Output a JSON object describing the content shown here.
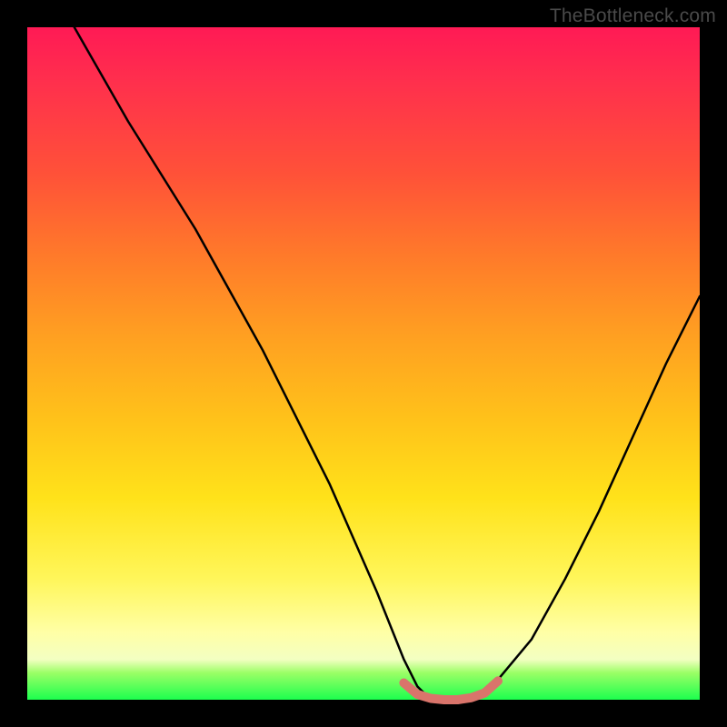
{
  "watermark": "TheBottleneck.com",
  "chart_data": {
    "type": "line",
    "title": "",
    "xlabel": "",
    "ylabel": "",
    "xlim": [
      0,
      100
    ],
    "ylim": [
      0,
      100
    ],
    "grid": false,
    "legend": false,
    "background_gradient": {
      "stops": [
        {
          "pct": 0,
          "color": "#ff1a55"
        },
        {
          "pct": 22,
          "color": "#ff5238"
        },
        {
          "pct": 46,
          "color": "#ffa021"
        },
        {
          "pct": 70,
          "color": "#ffe21a"
        },
        {
          "pct": 90,
          "color": "#ffffa6"
        },
        {
          "pct": 96,
          "color": "#9bff66"
        },
        {
          "pct": 100,
          "color": "#1cff4e"
        }
      ]
    },
    "series": [
      {
        "name": "left-branch",
        "color": "#000000",
        "x": [
          7,
          15,
          25,
          35,
          45,
          52,
          56,
          58,
          60
        ],
        "y": [
          100,
          86,
          70,
          52,
          32,
          16,
          6,
          2,
          0
        ]
      },
      {
        "name": "valley-floor",
        "color": "#d9746b",
        "width": 6,
        "x": [
          56,
          58,
          60,
          62,
          64,
          66,
          68,
          70
        ],
        "y": [
          2.5,
          0.8,
          0.2,
          0.0,
          0.0,
          0.3,
          1.0,
          2.8
        ]
      },
      {
        "name": "right-branch",
        "color": "#000000",
        "x": [
          66,
          70,
          75,
          80,
          85,
          90,
          95,
          100
        ],
        "y": [
          0,
          3,
          9,
          18,
          28,
          39,
          50,
          60
        ]
      }
    ]
  }
}
